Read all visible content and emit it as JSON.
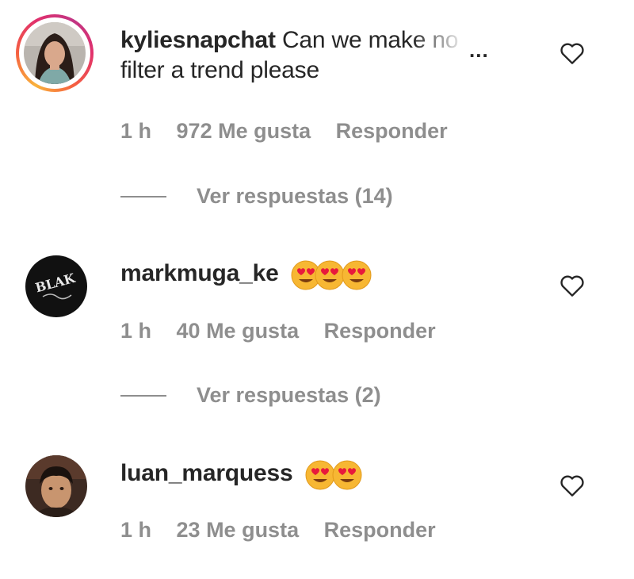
{
  "comments": [
    {
      "username": "kyliesnapchat",
      "text_visible": "Can we ma",
      "text_faded": "ke no",
      "text_line2": "filter a trend please",
      "more": "...",
      "time": "1 h",
      "likes": "972 Me gusta",
      "reply": "Responder",
      "replies": "Ver respuestas (14)",
      "avatar_icon": "woman-portrait-avatar",
      "story_ring": true
    },
    {
      "username": "markmuga_ke",
      "emoji": "heart-eyes-face ×3",
      "time": "1 h",
      "likes": "40 Me gusta",
      "reply": "Responder",
      "replies": "Ver respuestas (2)",
      "avatar_icon": "blak-logo-avatar",
      "avatar_text": "BLAK"
    },
    {
      "username": "luan_marquess",
      "emoji": "heart-eyes-face ×2",
      "time": "1 h",
      "likes": "23 Me gusta",
      "reply": "Responder",
      "avatar_icon": "man-portrait-avatar"
    }
  ],
  "colors": {
    "text": "#262626",
    "secondary": "#8e8e8e",
    "background": "#ffffff"
  },
  "icons": {
    "like": "heart-outline-icon",
    "emoji": "heart-eyes-emoji"
  }
}
